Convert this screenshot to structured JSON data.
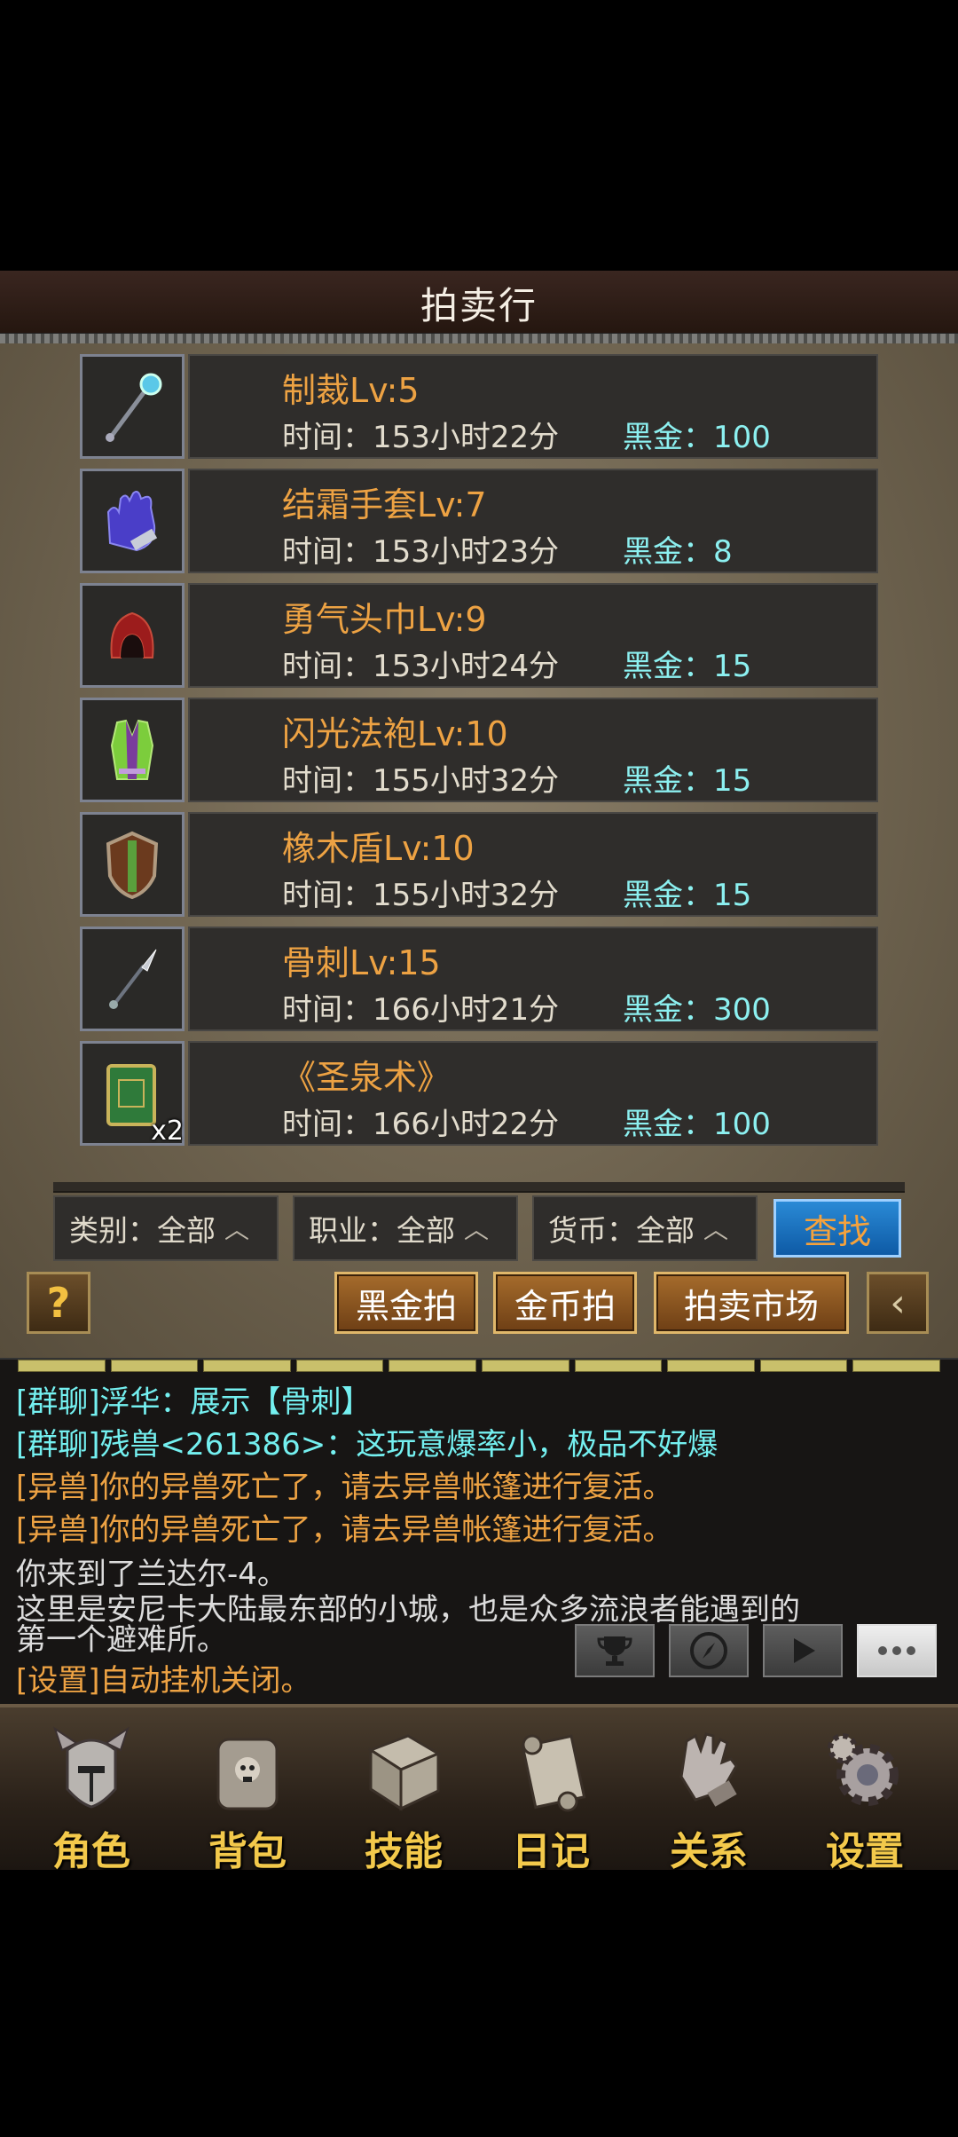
{
  "title": "拍卖行",
  "items": [
    {
      "name": "制裁Lv:5",
      "time": "时间：153小时22分",
      "price": "黑金：100",
      "icon": "scepter-icon"
    },
    {
      "name": "结霜手套Lv:7",
      "time": "时间：153小时23分",
      "price": "黑金：8",
      "icon": "glove-icon"
    },
    {
      "name": "勇气头巾Lv:9",
      "time": "时间：153小时24分",
      "price": "黑金：15",
      "icon": "hood-icon"
    },
    {
      "name": "闪光法袍Lv:10",
      "time": "时间：155小时32分",
      "price": "黑金：15",
      "icon": "robe-icon"
    },
    {
      "name": "橡木盾Lv:10",
      "time": "时间：155小时32分",
      "price": "黑金：15",
      "icon": "shield-icon"
    },
    {
      "name": "骨刺Lv:15",
      "time": "时间：166小时21分",
      "price": "黑金：300",
      "icon": "spear-icon"
    },
    {
      "name": "《圣泉术》",
      "time": "时间：166小时22分",
      "price": "黑金：100",
      "icon": "book-icon",
      "count": "x2"
    }
  ],
  "filters": {
    "category": "类别：全部",
    "profession": "职业：全部",
    "currency": "货币：全部"
  },
  "search_label": "查找",
  "help_label": "?",
  "actions": {
    "black_gold": "黑金拍",
    "gold_coin": "金币拍",
    "market": "拍卖市场"
  },
  "chat": [
    {
      "text": "[群聊]浮华：展示【骨刺】",
      "color": "cyan"
    },
    {
      "text": "[群聊]残兽<261386>：这玩意爆率小，极品不好爆",
      "color": "cyan"
    },
    {
      "text": "[异兽]你的异兽死亡了，请去异兽帐篷进行复活。",
      "color": "orange"
    },
    {
      "text": "[异兽]你的异兽死亡了，请去异兽帐篷进行复活。",
      "color": "orange"
    },
    {
      "text": "你来到了兰达尔-4。",
      "color": "white"
    },
    {
      "text": "这里是安尼卡大陆最东部的小城，也是众多流浪者能遇到的",
      "color": "white"
    },
    {
      "text": "第一个避难所。",
      "color": "white"
    },
    {
      "text": "[设置]自动挂机关闭。",
      "color": "orange"
    }
  ],
  "nav": [
    {
      "label": "角色",
      "icon": "helmet-icon"
    },
    {
      "label": "背包",
      "icon": "backpack-icon"
    },
    {
      "label": "技能",
      "icon": "skill-book-icon"
    },
    {
      "label": "日记",
      "icon": "scroll-icon"
    },
    {
      "label": "关系",
      "icon": "gauntlet-icon"
    },
    {
      "label": "设置",
      "icon": "gear-icon"
    }
  ],
  "colors": {
    "item_name": "#eda243",
    "price": "#8cf0f0",
    "nav_label": "#f3c94b"
  }
}
